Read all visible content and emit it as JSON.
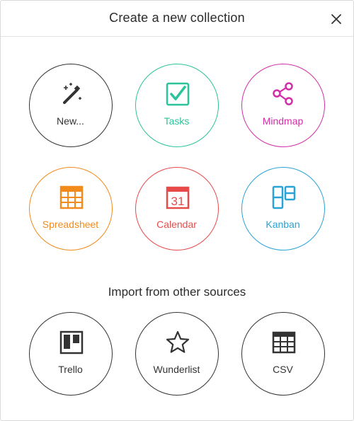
{
  "dialog": {
    "title": "Create a new collection",
    "close_icon": "close-icon"
  },
  "create_options": [
    {
      "label": "New...",
      "icon": "magic-wand-icon",
      "color": "#333333"
    },
    {
      "label": "Tasks",
      "icon": "checkbox-icon",
      "color": "#2bc39a"
    },
    {
      "label": "Mindmap",
      "icon": "mindmap-icon",
      "color": "#d12fa8"
    },
    {
      "label": "Spreadsheet",
      "icon": "spreadsheet-icon",
      "color": "#f28a1c"
    },
    {
      "label": "Calendar",
      "icon": "calendar-icon",
      "color": "#e84a4a",
      "calendar_day": "31"
    },
    {
      "label": "Kanban",
      "icon": "kanban-icon",
      "color": "#2aa3d6"
    }
  ],
  "import": {
    "heading": "Import from other sources",
    "options": [
      {
        "label": "Trello",
        "icon": "trello-icon",
        "color": "#333333"
      },
      {
        "label": "Wunderlist",
        "icon": "star-icon",
        "color": "#333333"
      },
      {
        "label": "CSV",
        "icon": "table-icon",
        "color": "#333333"
      }
    ]
  }
}
